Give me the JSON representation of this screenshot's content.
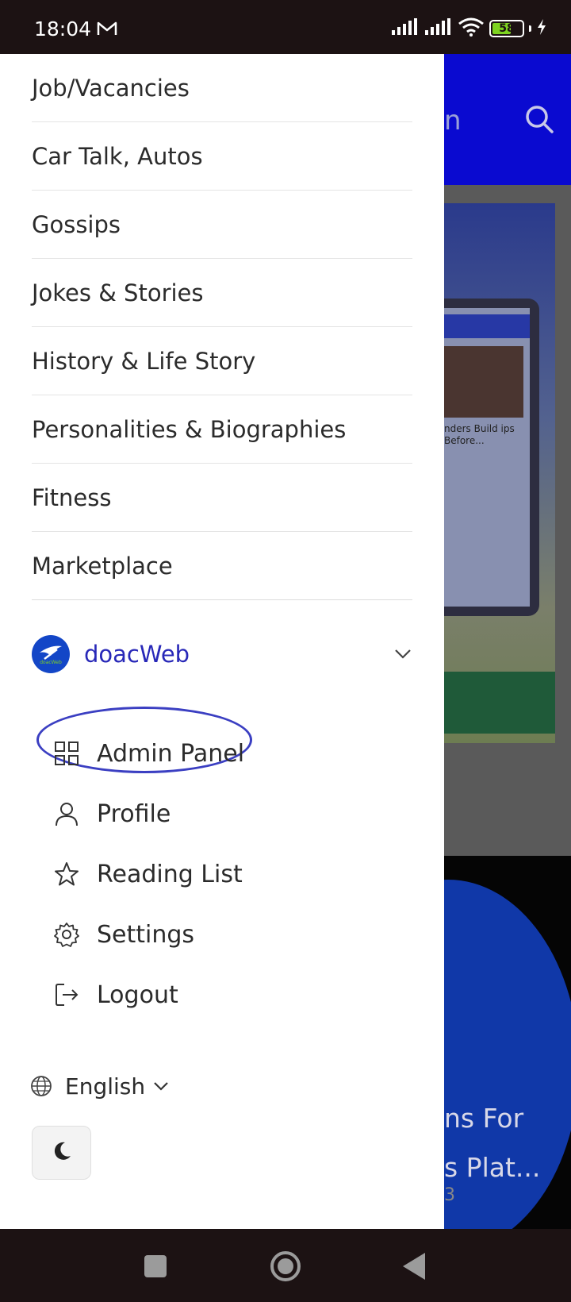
{
  "status_bar": {
    "time": "18:04",
    "battery": "58",
    "icons": [
      "gmail-icon",
      "signal-icon",
      "signal-icon",
      "wifi-icon",
      "battery-icon",
      "charging-icon"
    ]
  },
  "background": {
    "header_fragment": "n",
    "headline_line1": "ns For",
    "headline_line2": "s Plat...",
    "meta_fragment": "3",
    "phone_text": "nders Build ips Before..."
  },
  "drawer": {
    "categories": [
      {
        "label": "Job/Vacancies"
      },
      {
        "label": "Car Talk, Autos"
      },
      {
        "label": "Gossips"
      },
      {
        "label": "Jokes & Stories"
      },
      {
        "label": "History & Life Story"
      },
      {
        "label": "Personalities & Biographies"
      },
      {
        "label": "Fitness"
      },
      {
        "label": "Marketplace"
      }
    ],
    "user": {
      "name": "doacWeb",
      "avatar_text": "doacWeb"
    },
    "menu": [
      {
        "label": "Admin Panel",
        "icon": "grid-icon"
      },
      {
        "label": "Profile",
        "icon": "user-icon"
      },
      {
        "label": "Reading List",
        "icon": "star-icon"
      },
      {
        "label": "Settings",
        "icon": "gear-icon"
      },
      {
        "label": "Logout",
        "icon": "logout-icon"
      }
    ],
    "language": "English",
    "theme_icon": "moon-icon"
  },
  "colors": {
    "accent": "#2828b8",
    "highlight_oval": "#3b3fc2",
    "header_blue": "#0a0ad0"
  }
}
